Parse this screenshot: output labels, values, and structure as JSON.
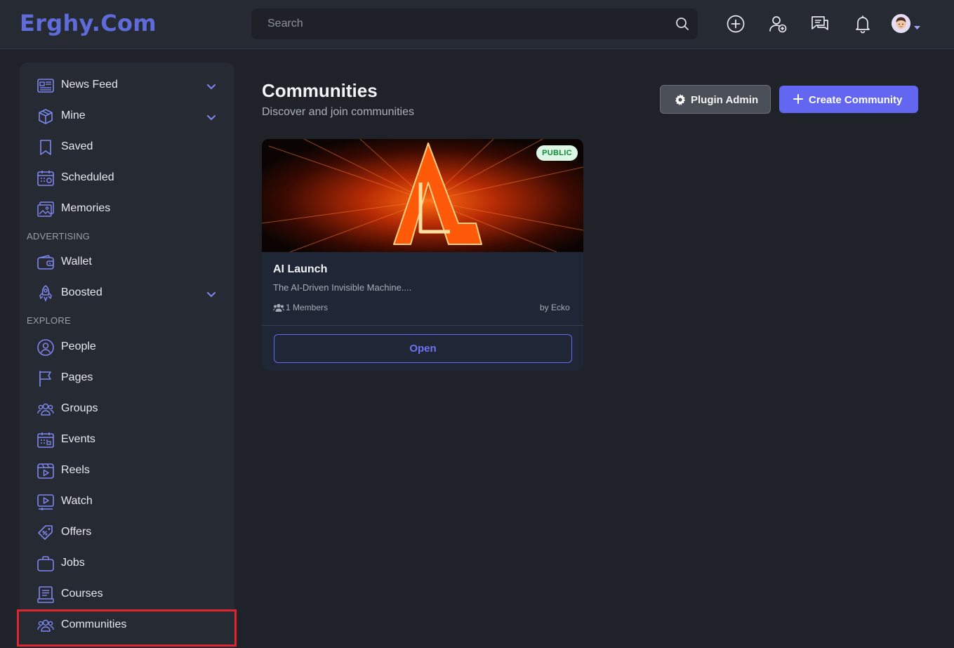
{
  "header": {
    "logo": "Erghy.Com",
    "search_placeholder": "Search"
  },
  "sidebar": {
    "items": [
      {
        "label": "News Feed",
        "icon": "newspaper-icon",
        "has_chevron": true
      },
      {
        "label": "Mine",
        "icon": "box-icon",
        "has_chevron": true
      },
      {
        "label": "Saved",
        "icon": "bookmark-icon"
      },
      {
        "label": "Scheduled",
        "icon": "calendar-clock-icon"
      },
      {
        "label": "Memories",
        "icon": "photos-icon"
      }
    ],
    "advertising_label": "ADVERTISING",
    "advertising_items": [
      {
        "label": "Wallet",
        "icon": "wallet-icon"
      },
      {
        "label": "Boosted",
        "icon": "rocket-icon",
        "has_chevron": true
      }
    ],
    "explore_label": "EXPLORE",
    "explore_items": [
      {
        "label": "People",
        "icon": "person-icon"
      },
      {
        "label": "Pages",
        "icon": "flag-icon"
      },
      {
        "label": "Groups",
        "icon": "group-icon"
      },
      {
        "label": "Events",
        "icon": "calendar-icon"
      },
      {
        "label": "Reels",
        "icon": "reels-icon"
      },
      {
        "label": "Watch",
        "icon": "video-icon"
      },
      {
        "label": "Offers",
        "icon": "tag-icon"
      },
      {
        "label": "Jobs",
        "icon": "briefcase-icon"
      },
      {
        "label": "Courses",
        "icon": "book-icon"
      },
      {
        "label": "Communities",
        "icon": "community-icon"
      }
    ]
  },
  "main": {
    "title": "Communities",
    "subtitle": "Discover and join communities",
    "plugin_admin_label": "Plugin Admin",
    "create_label": "Create Community"
  },
  "communities": [
    {
      "name": "AI Launch",
      "description": "The AI-Driven Invisible Machine....",
      "members": "1 Members",
      "author": "by Ecko",
      "badge": "PUBLIC",
      "open_label": "Open"
    }
  ],
  "colors": {
    "accent": "#6366f1",
    "background": "#1f2329",
    "panel": "#262b33",
    "highlight": "#e0252e"
  }
}
